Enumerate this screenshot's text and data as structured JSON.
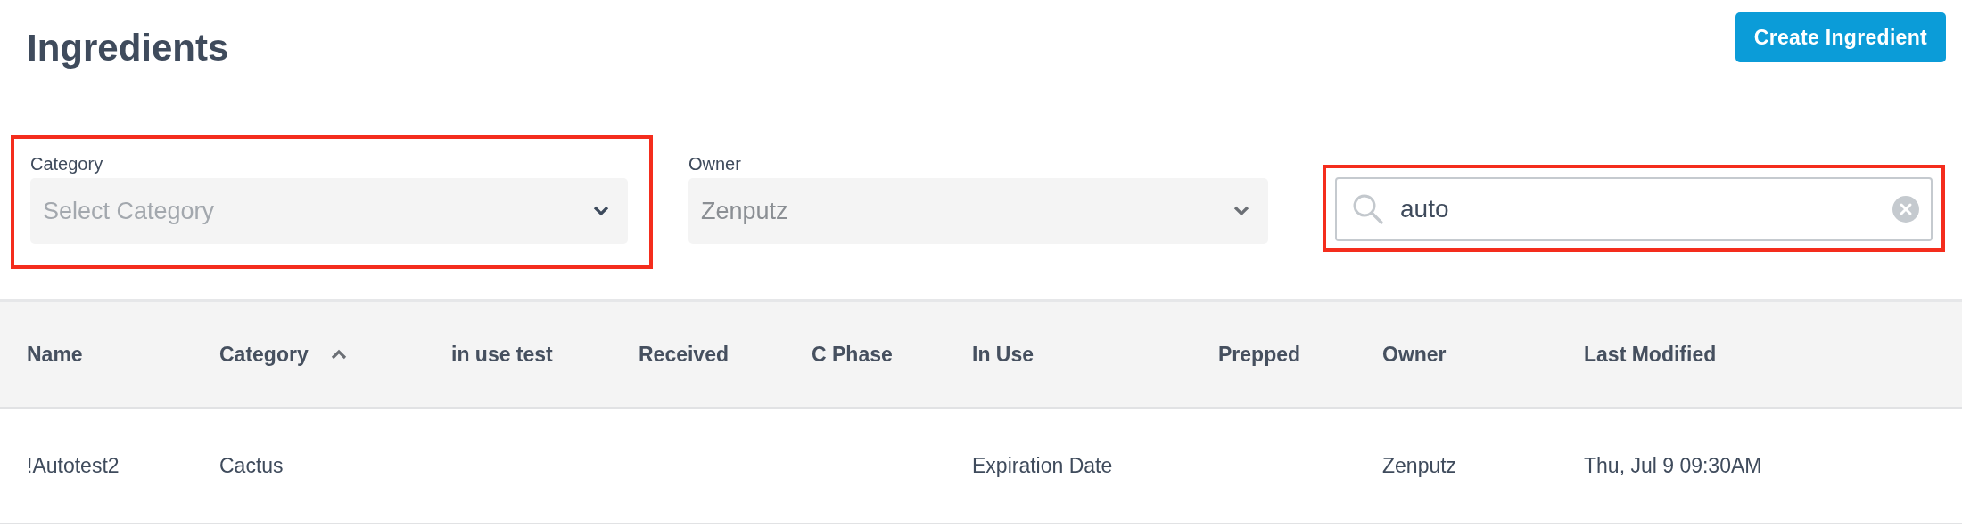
{
  "page": {
    "title": "Ingredients"
  },
  "create_button": {
    "label": "Create Ingredient"
  },
  "filters": [
    {
      "kind": "select",
      "label": "Category",
      "placeholder": "Select Category",
      "highlighted": true
    },
    {
      "kind": "select",
      "label": "Owner",
      "value": "Zenputz",
      "highlighted": false
    }
  ],
  "search": {
    "value": "auto",
    "highlighted": true
  },
  "table": {
    "columns": [
      {
        "label": "Name",
        "sorted_ascending": false
      },
      {
        "label": "Category",
        "sorted_ascending": true
      },
      {
        "label": "in use test",
        "sorted_ascending": false
      },
      {
        "label": "Received",
        "sorted_ascending": false
      },
      {
        "label": "C Phase",
        "sorted_ascending": false
      },
      {
        "label": "In Use",
        "sorted_ascending": false
      },
      {
        "label": "Prepped",
        "sorted_ascending": false
      },
      {
        "label": "Owner",
        "sorted_ascending": false
      },
      {
        "label": "Last Modified",
        "sorted_ascending": false
      }
    ],
    "rows": [
      {
        "cells": [
          "!Autotest2",
          "Cactus",
          null,
          null,
          null,
          "Expiration Date",
          null,
          "Zenputz",
          "Thu, Jul 9 09:30AM"
        ]
      }
    ]
  }
}
